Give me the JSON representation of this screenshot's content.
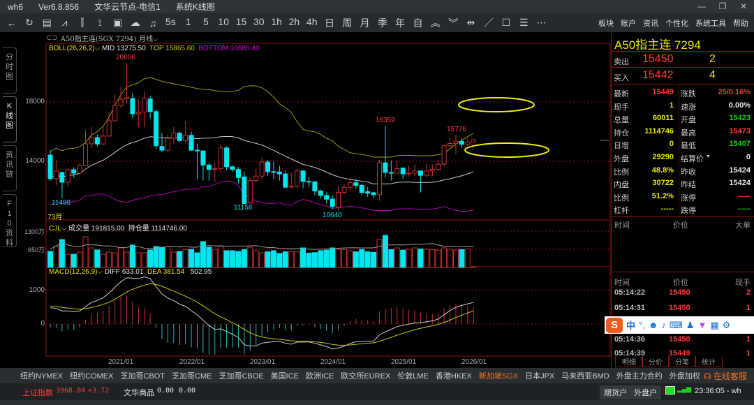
{
  "window": {
    "app": "wh6",
    "version": "Ver6.8.856",
    "server": "文华云节点-电信1",
    "view": "系统K线图"
  },
  "toolbar": {
    "periods": [
      "5s",
      "1",
      "5",
      "10",
      "15",
      "30",
      "1h",
      "2h",
      "4h",
      "日",
      "周",
      "月",
      "季",
      "年",
      "自"
    ],
    "menu": [
      "板块",
      "账户",
      "资讯",
      "个性化",
      "系统工具",
      "帮助"
    ]
  },
  "left_tabs": [
    "分时图",
    "K线图",
    "资讯链",
    "F10资料"
  ],
  "chart_header": {
    "symbol": "A50指主连(SGX 7294)",
    "period": "月线"
  },
  "boll": {
    "label": "BOLL(26,26,2)",
    "mid": "MID 13275.50",
    "top": "TOP 15865.60",
    "bottom": "BOTTOM 10685.40"
  },
  "vol": {
    "label": "CJL",
    "volume": "成交量 191815.00",
    "oi": "持仓量 1114746.00"
  },
  "macd": {
    "label": "MACD(12,26,9)",
    "diff": "DIFF 633.01",
    "dea": "DEA 381.54",
    "macd": "502.95"
  },
  "axes": {
    "price": [
      "18000",
      "14000"
    ],
    "volume": [
      "1300万",
      "650万"
    ],
    "macd": [
      "1000",
      "0"
    ],
    "x": [
      "2021/01",
      "2022/01",
      "2023/01",
      "2024/01",
      "2025/01",
      "2026/01"
    ],
    "count": "73月"
  },
  "annotations": {
    "high": "20606",
    "low1": "11498",
    "low2": "11158",
    "low3": "10640",
    "high2": "16359",
    "high3": "15776"
  },
  "chart_data": {
    "type": "candlestick",
    "ohlc": [
      [
        14420,
        12830,
        14750,
        12700
      ],
      [
        12830,
        13340,
        14050,
        12400
      ],
      [
        13250,
        12590,
        13300,
        11498
      ],
      [
        12590,
        13430,
        13500,
        12300
      ],
      [
        13430,
        13200,
        13600,
        12900
      ],
      [
        13200,
        13720,
        13900,
        13100
      ],
      [
        13720,
        15180,
        16100,
        13700
      ],
      [
        15180,
        15600,
        16300,
        14900
      ],
      [
        15600,
        15170,
        15800,
        15000
      ],
      [
        15170,
        15700,
        16300,
        15100
      ],
      [
        15700,
        16730,
        17300,
        15700
      ],
      [
        16730,
        17760,
        18500,
        16900
      ],
      [
        17760,
        18180,
        19000,
        17600
      ],
      [
        18200,
        18300,
        20606,
        17900
      ],
      [
        18240,
        17200,
        18600,
        16900
      ],
      [
        17200,
        17300,
        18200,
        16300
      ],
      [
        17320,
        18250,
        18700,
        16300
      ],
      [
        18200,
        17350,
        18400,
        16900
      ],
      [
        17350,
        15050,
        17500,
        14800
      ],
      [
        15000,
        14750,
        15900,
        14600
      ],
      [
        14750,
        15550,
        15800,
        14600
      ],
      [
        15550,
        15900,
        16300,
        15200
      ],
      [
        15900,
        15400,
        16000,
        15300
      ],
      [
        15400,
        15750,
        16700,
        15300
      ],
      [
        15750,
        14750,
        16000,
        14700
      ],
      [
        14750,
        14700,
        15200,
        12800
      ],
      [
        14700,
        13750,
        14700,
        12700
      ],
      [
        13750,
        13450,
        13900,
        12700
      ],
      [
        13450,
        13500,
        13900,
        12600
      ],
      [
        13500,
        14900,
        15100,
        13250
      ],
      [
        14900,
        13630,
        15000,
        13400
      ],
      [
        13630,
        13450,
        13700,
        13300
      ],
      [
        13450,
        12900,
        13600,
        12500
      ],
      [
        12950,
        11158,
        13300,
        11158
      ],
      [
        11200,
        12700,
        12900,
        11100
      ],
      [
        12700,
        13000,
        13500,
        12600
      ],
      [
        13000,
        13950,
        14300,
        12800
      ],
      [
        13950,
        13300,
        14100,
        13000
      ],
      [
        13300,
        13250,
        14000,
        12800
      ],
      [
        13280,
        13150,
        13700,
        12700
      ],
      [
        13150,
        12250,
        13400,
        12200
      ],
      [
        12260,
        12330,
        13200,
        12200
      ],
      [
        12330,
        13350,
        13500,
        12200
      ],
      [
        13350,
        12650,
        13400,
        12200
      ],
      [
        12650,
        12620,
        12950,
        12250
      ],
      [
        12620,
        12000,
        12650,
        11700
      ],
      [
        12000,
        11700,
        12100,
        11500
      ],
      [
        11700,
        11450,
        11900,
        11150
      ],
      [
        11450,
        10950,
        11700,
        10800
      ],
      [
        10900,
        11900,
        12300,
        10640
      ],
      [
        11900,
        12250,
        12450,
        11800
      ],
      [
        12250,
        12560,
        12900,
        11950
      ],
      [
        12560,
        12380,
        12800,
        12150
      ],
      [
        12380,
        11900,
        12500,
        11750
      ],
      [
        11950,
        11850,
        12250,
        11600
      ],
      [
        11880,
        11750,
        11950,
        11550
      ],
      [
        11750,
        13900,
        14100,
        11350
      ],
      [
        13900,
        13250,
        16359,
        12900
      ],
      [
        13250,
        13200,
        14050,
        12700
      ],
      [
        13200,
        13500,
        14050,
        13200
      ],
      [
        13550,
        13150,
        13550,
        12800
      ],
      [
        13150,
        13200,
        13700,
        12950
      ],
      [
        13200,
        13350,
        13800,
        13000
      ],
      [
        13350,
        13050,
        13350,
        11900
      ],
      [
        13050,
        13350,
        13800,
        12900
      ],
      [
        13350,
        13450,
        13800,
        13000
      ],
      [
        13450,
        13800,
        14100,
        13350
      ],
      [
        13800,
        15050,
        15100,
        13650
      ],
      [
        15050,
        15200,
        15600,
        14900
      ],
      [
        15200,
        15350,
        15776,
        14500
      ],
      [
        15350,
        15150,
        15550,
        14900
      ],
      [
        15150,
        15300,
        15550,
        15050
      ],
      [
        15300,
        15449,
        15500,
        15300
      ]
    ],
    "volume_wan": [
      575,
      750,
      1000,
      475,
      475,
      550,
      1100,
      700,
      625,
      475,
      550,
      525,
      700,
      550,
      800,
      525,
      525,
      625,
      750,
      725,
      740,
      550,
      575,
      640,
      650,
      525,
      925,
      725,
      650,
      760,
      600,
      600,
      575,
      640,
      725,
      600,
      525,
      560,
      600,
      500,
      560,
      560,
      560,
      700,
      510,
      530,
      600,
      620,
      700,
      650,
      640,
      600,
      560,
      640,
      560,
      540,
      1000,
      1150,
      640,
      700,
      620,
      650,
      700,
      660,
      650,
      640,
      620,
      700,
      650,
      620,
      640,
      660,
      19
    ],
    "price_range": [
      10000,
      20700
    ],
    "colors": {
      "up": "#c8302e",
      "down": "#00e5ee",
      "mid": "#c8c8c8",
      "top": "#9a9a00",
      "bottom": "#b000b0",
      "diff": "#cfcfcf",
      "dea": "#c8c800"
    }
  },
  "quote": {
    "title": "A50指主连  7294",
    "ask_label": "卖出",
    "ask": "15450",
    "ask_qty": "2",
    "bid_label": "买入",
    "bid": "15442",
    "bid_qty": "4",
    "stats": [
      [
        "最新",
        "15449",
        "r",
        "涨跌",
        "25/0.16%",
        "r"
      ],
      [
        "现手",
        "1",
        "y",
        "速涨",
        "0.00%",
        "w"
      ],
      [
        "总量",
        "60011",
        "y",
        "开盘",
        "15423",
        "g"
      ],
      [
        "持仓",
        "1114746",
        "y",
        "最高",
        "15473",
        "r"
      ],
      [
        "日增",
        "0",
        "y",
        "最低",
        "15407",
        "g"
      ],
      [
        "外盘",
        "29290",
        "y",
        "结算价",
        "0",
        "w"
      ],
      [
        "比例",
        "48.8%",
        "y",
        "昨收",
        "15424",
        "w"
      ],
      [
        "内盘",
        "30722",
        "y",
        "昨结",
        "15424",
        "w"
      ],
      [
        "比例",
        "51.2%",
        "y",
        "涨停",
        "-----",
        "r"
      ],
      [
        "杠杆",
        "-----",
        "y",
        "跌停",
        "-----",
        "g"
      ]
    ],
    "big_head": [
      "时间",
      "价位",
      "大单"
    ],
    "tick_head": [
      "时间",
      "价位",
      "现手"
    ],
    "ticks": [
      [
        "05:14:22",
        "15450",
        "2"
      ],
      [
        "05:14:31",
        "15450",
        "1"
      ],
      [
        "05:14:36",
        "15450",
        "1"
      ],
      [
        "05:14:39",
        "15449",
        "1"
      ]
    ],
    "tabs": [
      "明细",
      "分价",
      "分笔",
      "统计"
    ]
  },
  "exchanges": [
    "纽约NYMEX",
    "纽约COMEX",
    "芝加哥CBOT",
    "芝加哥CME",
    "芝加哥CBOE",
    "美国ICE",
    "欧洲ICE",
    "欧交所EUREX",
    "伦敦LME",
    "香港HKEX",
    "新加坡SGX",
    "日本JPX",
    "马来西亚BMD",
    "外盘主力合约",
    "外盘加权"
  ],
  "active_exchange": "新加坡SGX",
  "service": "在线客服",
  "status": {
    "index_name": "上证指数",
    "index_val": "3968.84",
    "index_chg": "+3.72",
    "wh_name": "文华商品",
    "wh_val": "0.00",
    "wh_chg": "0.00",
    "btn1": "期货户",
    "btn2": "外盘户",
    "time": "23:36:05 - wh"
  },
  "ime": {
    "lang": "中"
  }
}
